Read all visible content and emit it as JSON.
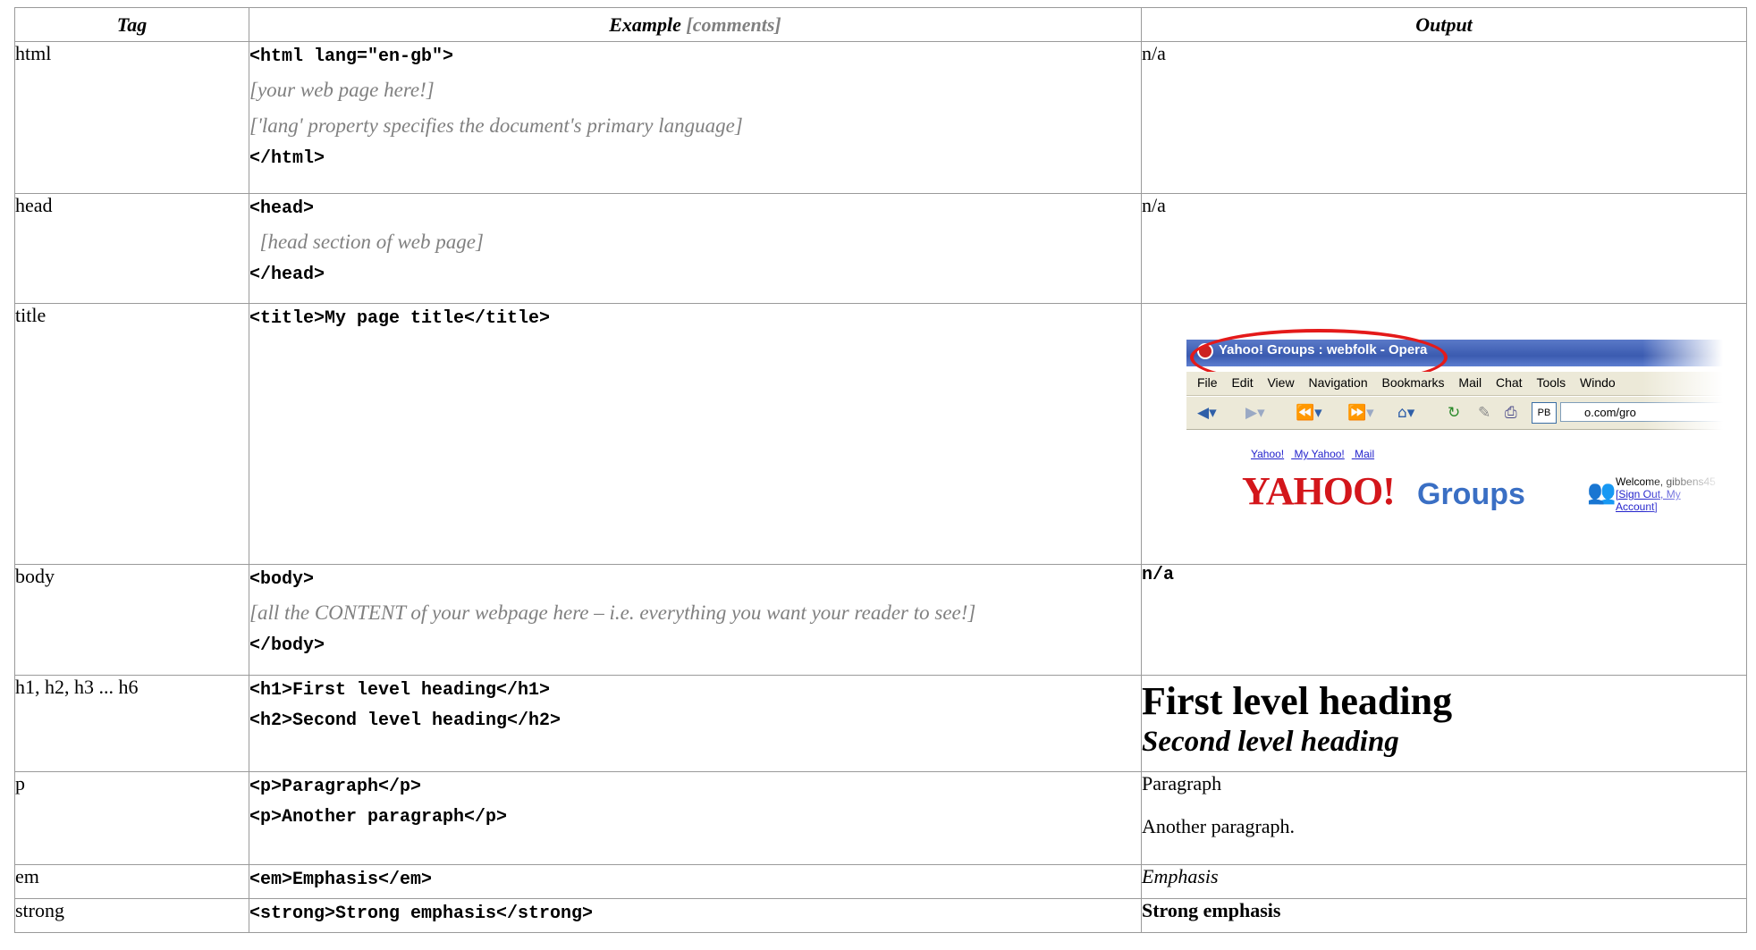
{
  "header": {
    "tag": "Tag",
    "example": "Example",
    "comments": "[comments]",
    "output": "Output"
  },
  "rows": [
    {
      "tag": "html",
      "lines": [
        {
          "kind": "code",
          "text": "<html lang=\"en-gb\">"
        },
        {
          "kind": "comment",
          "text": "[your web page here!]"
        },
        {
          "kind": "comment",
          "text": "['lang' property specifies the document's primary language]"
        },
        {
          "kind": "code",
          "text": "</html>"
        }
      ],
      "output": "n/a"
    },
    {
      "tag": "head",
      "lines": [
        {
          "kind": "code",
          "text": "<head>"
        },
        {
          "kind": "comment",
          "text": "  [head section of web page]"
        },
        {
          "kind": "code",
          "text": "</head>"
        }
      ],
      "output": "n/a"
    },
    {
      "tag": "title",
      "lines": [
        {
          "kind": "code",
          "text": "<title>My page title</title>"
        }
      ],
      "screenshot": {
        "window_title": "Yahoo! Groups : webfolk - Opera",
        "menu": [
          "File",
          "Edit",
          "View",
          "Navigation",
          "Bookmarks",
          "Mail",
          "Chat",
          "Tools",
          "Windo"
        ],
        "address": "o.com/gro",
        "pb": "PB",
        "links": [
          "Yahoo!",
          "My Yahoo!",
          "Mail"
        ],
        "logo": "YAHOO!",
        "groups": "Groups",
        "welcome": "Welcome, gibbens45",
        "signout": "[Sign Out, My",
        "account": "Account]"
      }
    },
    {
      "tag": "body",
      "lines": [
        {
          "kind": "code",
          "text": "<body>"
        },
        {
          "kind": "comment",
          "text": "[all the CONTENT of your webpage here – i.e. everything you want your reader to see!]"
        },
        {
          "kind": "code",
          "text": "</body>"
        }
      ],
      "output": "n/a"
    },
    {
      "tag": "h1, h2, h3 ... h6",
      "lines": [
        {
          "kind": "code",
          "text": "<h1>First level heading</h1>"
        },
        {
          "kind": "code",
          "text": "<h2>Second level heading</h2>"
        }
      ],
      "out_h1": "First level heading",
      "out_h2": "Second level heading"
    },
    {
      "tag": "p",
      "lines": [
        {
          "kind": "code",
          "text": "<p>Paragraph</p>"
        },
        {
          "kind": "code",
          "text": "<p>Another paragraph</p>"
        }
      ],
      "out_p1": "Paragraph",
      "out_p2": "Another paragraph."
    },
    {
      "tag": "em",
      "lines": [
        {
          "kind": "code",
          "text": "<em>Emphasis</em>"
        }
      ],
      "output": "Emphasis"
    },
    {
      "tag": "strong",
      "lines": [
        {
          "kind": "code",
          "text": "<strong>Strong emphasis</strong>"
        }
      ],
      "output": "Strong emphasis"
    }
  ]
}
